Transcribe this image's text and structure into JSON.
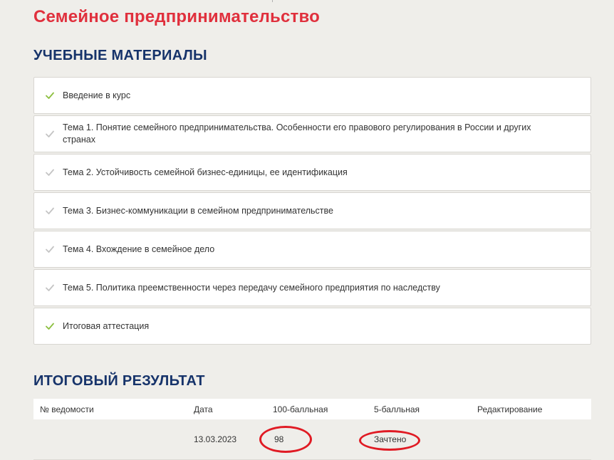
{
  "page": {
    "title": "Семейное предпринимательство"
  },
  "materials": {
    "heading": "УЧЕБНЫЕ МАТЕРИАЛЫ",
    "items": [
      {
        "label": "Введение в курс",
        "completed": true
      },
      {
        "label": "Тема 1. Понятие семейного предпринимательства. Особенности его правового регулирования в России и других странах",
        "completed": false
      },
      {
        "label": "Тема 2. Устойчивость семейной бизнес-единицы, ее идентификация",
        "completed": false
      },
      {
        "label": "Тема 3. Бизнес-коммуникации в семейном предпринимательстве",
        "completed": false
      },
      {
        "label": "Тема 4. Вхождение в семейное дело",
        "completed": false
      },
      {
        "label": "Тема 5. Политика преемственности через передачу семейного предприятия по наследству",
        "completed": false
      },
      {
        "label": "Итоговая аттестация",
        "completed": true
      }
    ]
  },
  "results": {
    "heading": "ИТОГОВЫЙ РЕЗУЛЬТАТ",
    "columns": {
      "statement": "№ ведомости",
      "date": "Дата",
      "score100": "100-балльная",
      "score5": "5-балльная",
      "edit": "Редактирование"
    },
    "row": {
      "statement": "",
      "date": "13.03.2023",
      "score100": "98",
      "score5": "Зачтено",
      "edit": ""
    }
  },
  "colors": {
    "title": "#e0303d",
    "heading": "#16336a",
    "check_done": "#8cbf3f",
    "check_pending": "#c4c4c4",
    "annotation": "#e01b24"
  },
  "icons": {
    "check": "checkmark-icon"
  }
}
